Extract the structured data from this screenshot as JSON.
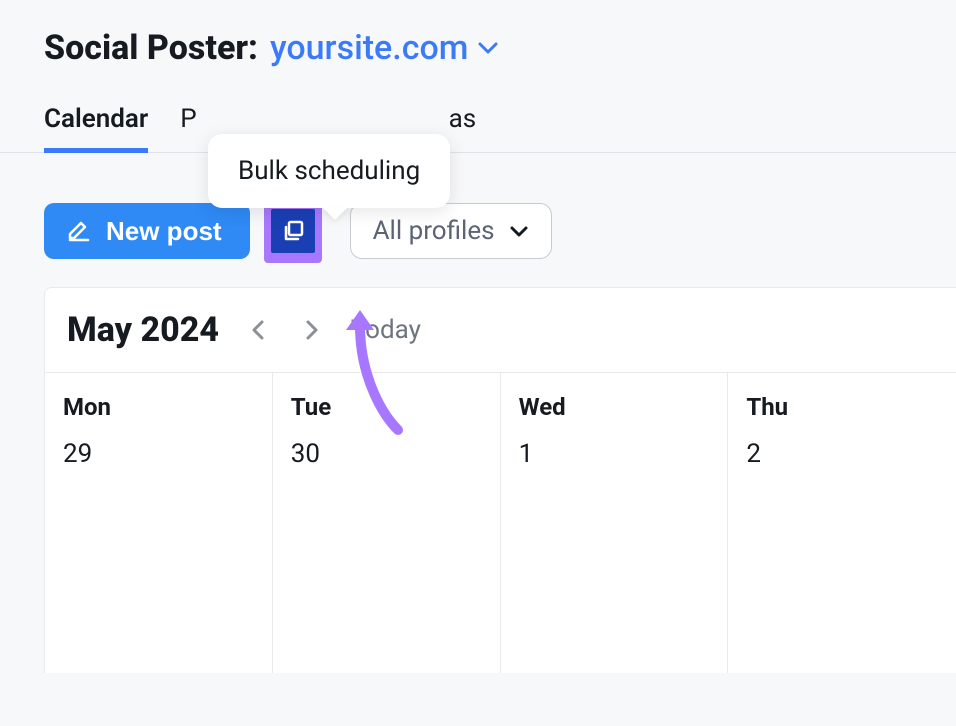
{
  "header": {
    "prefix": "Social Poster:",
    "domain": "yoursite.com"
  },
  "tabs": {
    "calendar": "Calendar",
    "posts": "Posts",
    "ideas": "as"
  },
  "tooltip": {
    "bulk": "Bulk scheduling"
  },
  "toolbar": {
    "new_post": "New post",
    "profiles": "All profiles"
  },
  "calendar": {
    "month": "May 2024",
    "today": "Today",
    "days": [
      {
        "name": "Mon",
        "num": "29"
      },
      {
        "name": "Tue",
        "num": "30"
      },
      {
        "name": "Wed",
        "num": "1"
      },
      {
        "name": "Thu",
        "num": "2"
      }
    ]
  },
  "colors": {
    "accent_blue": "#2f8af5",
    "link_blue": "#3b7bf7",
    "highlight_purple": "#a778ff",
    "bulk_bg": "#1a3fb4"
  }
}
